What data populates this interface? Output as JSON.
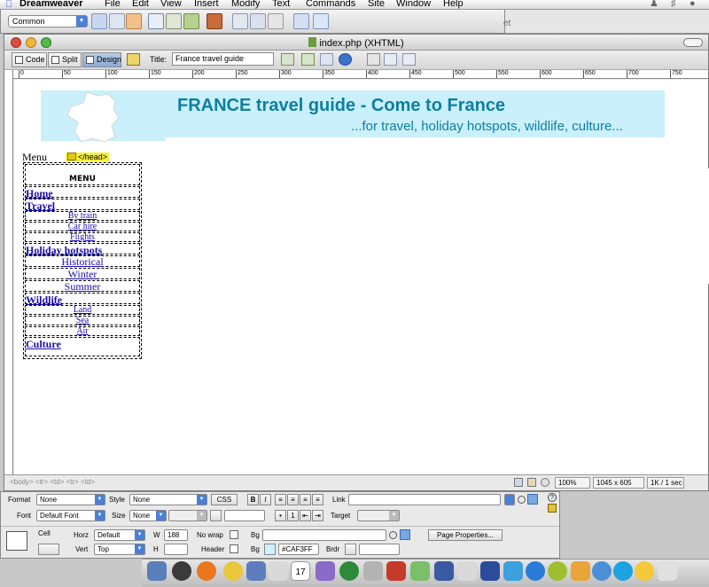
{
  "menubar": {
    "app": "Dreamweaver",
    "items": [
      "File",
      "Edit",
      "View",
      "Insert",
      "Modify",
      "Text",
      "Commands",
      "Site",
      "Window",
      "Help"
    ]
  },
  "insertbar": {
    "category": "Common"
  },
  "background_window": {
    "fragment": "et"
  },
  "document": {
    "title": "index.php (XHTML)",
    "view_buttons": [
      "Code",
      "Split",
      "Design"
    ],
    "active_view": "Design",
    "title_label": "Title:",
    "page_title": "France travel guide"
  },
  "ruler": {
    "marks": [
      "0",
      "50",
      "100",
      "150",
      "200",
      "250",
      "300",
      "350",
      "400",
      "450",
      "500",
      "550",
      "600",
      "650",
      "700",
      "750"
    ]
  },
  "page": {
    "banner_title": "FRANCE travel guide - Come to France",
    "banner_subtitle": "...for travel, holiday hotspots, wildlife, culture...",
    "menu_label": "Menu",
    "head_tag": "</head>",
    "menu_header": "MENU",
    "menu": [
      {
        "text": "Home",
        "kind": "cat"
      },
      {
        "text": "Travel",
        "kind": "cat"
      },
      {
        "text": "By train",
        "kind": "sub"
      },
      {
        "text": "Car hire",
        "kind": "sub"
      },
      {
        "text": "Flights",
        "kind": "sub"
      },
      {
        "text": "Holiday hotspots",
        "kind": "cat"
      },
      {
        "text": "Historical",
        "kind": "sub2"
      },
      {
        "text": "Winter",
        "kind": "sub2"
      },
      {
        "text": "Summer",
        "kind": "sub2"
      },
      {
        "text": "Wildlife",
        "kind": "cat"
      },
      {
        "text": "Land",
        "kind": "sub"
      },
      {
        "text": "Sea",
        "kind": "sub"
      },
      {
        "text": "Air",
        "kind": "sub"
      },
      {
        "text": "Culture",
        "kind": "cat"
      }
    ]
  },
  "statusbar": {
    "tags": "<body> <tr> <td> <tr> <td>",
    "zoom": "100%",
    "size": "1045 x 605",
    "speed": "1K / 1 sec"
  },
  "properties": {
    "format_label": "Format",
    "format": "None",
    "style_label": "Style",
    "style": "None",
    "css": "CSS",
    "link_label": "Link",
    "font_label": "Font",
    "font": "Default Font",
    "size_label": "Size",
    "size": "None",
    "target_label": "Target",
    "cell_label": "Cell",
    "horz_label": "Horz",
    "horz": "Default",
    "w_label": "W",
    "w": "188",
    "nowrap_label": "No wrap",
    "bg_label": "Bg",
    "page_properties": "Page Properties...",
    "vert_label": "Vert",
    "vert": "Top",
    "h_label": "H",
    "header_label": "Header",
    "bg2_label": "Bg",
    "bg_color": "#CAF3FF",
    "brdr_label": "Brdr"
  },
  "dock": {
    "calendar_day": "17"
  },
  "colors": {
    "banner": "#c9f0fb",
    "banner_text": "#0f7ea3",
    "link": "#1a0dab",
    "head_tag": "#f6ee3a"
  }
}
